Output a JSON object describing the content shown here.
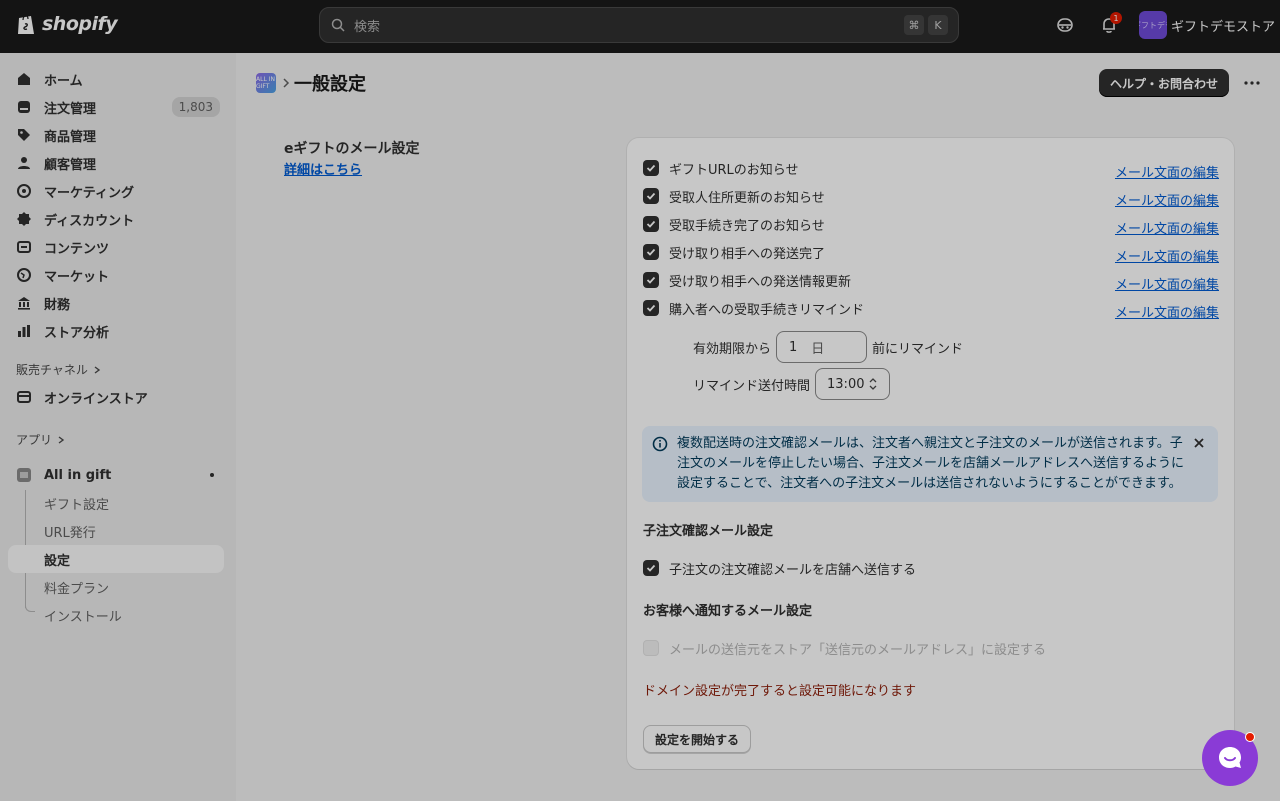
{
  "topbar": {
    "logo_text": "shopify",
    "search_placeholder": "検索",
    "shortcut_keys": [
      "⌘",
      "K"
    ],
    "notification_count": "1",
    "store_avatar_text": "ギフトデモ",
    "store_name": "ギフトデモストア"
  },
  "sidebar": {
    "items": [
      {
        "label": "ホーム",
        "icon": "home-icon"
      },
      {
        "label": "注文管理",
        "icon": "order-icon",
        "badge": "1,803"
      },
      {
        "label": "商品管理",
        "icon": "tag-icon"
      },
      {
        "label": "顧客管理",
        "icon": "person-icon"
      },
      {
        "label": "マーケティング",
        "icon": "target-icon"
      },
      {
        "label": "ディスカウント",
        "icon": "discount-icon"
      },
      {
        "label": "コンテンツ",
        "icon": "content-icon"
      },
      {
        "label": "マーケット",
        "icon": "globe-icon"
      },
      {
        "label": "財務",
        "icon": "bank-icon"
      },
      {
        "label": "ストア分析",
        "icon": "chart-icon"
      }
    ],
    "sales_channels_title": "販売チャネル",
    "online_store": "オンラインストア",
    "apps_title": "アプリ",
    "app_name": "All in gift",
    "app_subitems": [
      "ギフト設定",
      "URL発行",
      "設定",
      "料金プラン",
      "インストール"
    ],
    "active_subitem": "設定"
  },
  "header": {
    "app_icon_text": "ALL IN GIFT",
    "title": "一般設定",
    "help_button": "ヘルプ・お問合わせ"
  },
  "section": {
    "title": "eギフトのメール設定",
    "link": "詳細はこちら"
  },
  "notifications": [
    {
      "label": "ギフトURLのお知らせ",
      "checked": true,
      "edit": "メール文面の編集"
    },
    {
      "label": "受取人住所更新のお知らせ",
      "checked": true,
      "edit": "メール文面の編集"
    },
    {
      "label": "受取手続き完了のお知らせ",
      "checked": true,
      "edit": "メール文面の編集"
    },
    {
      "label": "受け取り相手への発送完了",
      "checked": true,
      "edit": "メール文面の編集"
    },
    {
      "label": "受け取り相手への発送情報更新",
      "checked": true,
      "edit": "メール文面の編集"
    },
    {
      "label": "購入者への受取手続きリマインド",
      "checked": true,
      "edit": "メール文面の編集"
    }
  ],
  "reminder": {
    "prefix": "有効期限から",
    "days_value": "1",
    "days_suffix": "日",
    "postfix": "前にリマインド",
    "time_label": "リマインド送付時間",
    "time_value": "13:00"
  },
  "banner": {
    "text": "複数配送時の注文確認メールは、注文者へ親注文と子注文のメールが送信されます。子注文のメールを停止したい場合、子注文メールを店舗メールアドレスへ送信するように設定することで、注文者への子注文メールは送信されないようにすることができます。"
  },
  "child_order": {
    "title": "子注文確認メール設定",
    "checkbox_label": "子注文の注文確認メールを店舗へ送信する",
    "checked": true
  },
  "customer_mail": {
    "title": "お客様へ通知するメール設定",
    "checkbox_label": "メールの送信元をストア「送信元のメールアドレス」に設定する",
    "checked": false,
    "warning": "ドメイン設定が完了すると設定可能になります",
    "start_button": "設定を開始する"
  },
  "colors": {
    "accent": "#303030",
    "link": "#005bd3",
    "warning": "#8e1f0b",
    "banner_bg": "#eaf4ff",
    "chat": "#8a3bd6"
  }
}
